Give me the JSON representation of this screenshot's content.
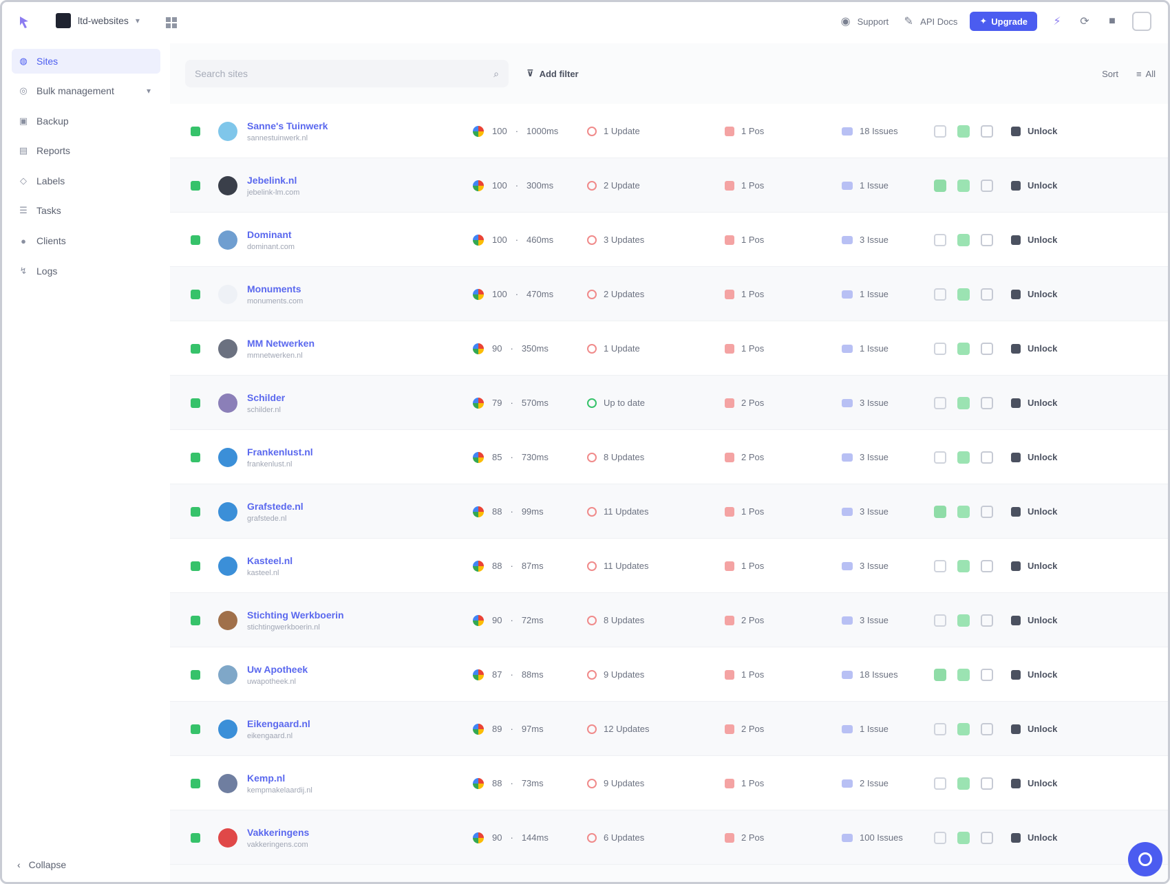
{
  "topbar": {
    "project_name": "ltd-websites",
    "support_label": "Support",
    "api_docs_label": "API Docs",
    "upgrade_label": "Upgrade"
  },
  "sidebar": {
    "items": [
      {
        "label": "Sites",
        "icon": "globe-icon",
        "active": true
      },
      {
        "label": "Bulk management",
        "icon": "layers-icon",
        "has_caret": true
      },
      {
        "label": "Backup",
        "icon": "database-icon"
      },
      {
        "label": "Reports",
        "icon": "file-icon"
      },
      {
        "label": "Labels",
        "icon": "tag-icon"
      },
      {
        "label": "Tasks",
        "icon": "checklist-icon"
      },
      {
        "label": "Clients",
        "icon": "users-icon"
      },
      {
        "label": "Logs",
        "icon": "log-icon"
      }
    ],
    "collapse_label": "Collapse"
  },
  "filters": {
    "search_placeholder": "Search sites",
    "add_filter_label": "Add filter",
    "sort_label": "Sort",
    "all_label": "All"
  },
  "colors": {
    "accent": "#4b5cf0",
    "status_ok": "#36c26a",
    "warning": "#f08a8a"
  },
  "sites": [
    {
      "name": "Sanne's Tuinwerk",
      "url": "sannestuinwerk.nl",
      "icon_color": "#7fc6ea",
      "perf_score": "100",
      "perf_time": "1000ms",
      "updates": "1 Update",
      "updates_ok": false,
      "backups": "1 Pos",
      "issues": "18 Issues",
      "act_green": false,
      "manager": "Unlock"
    },
    {
      "name": "Jebelink.nl",
      "url": "jebelink-lm.com",
      "icon_color": "#3a3f4a",
      "perf_score": "100",
      "perf_time": "300ms",
      "updates": "2 Update",
      "updates_ok": false,
      "backups": "1 Pos",
      "issues": "1 Issue",
      "act_green": true,
      "manager": "Unlock"
    },
    {
      "name": "Dominant",
      "url": "dominant.com",
      "icon_color": "#6f9ed0",
      "perf_score": "100",
      "perf_time": "460ms",
      "updates": "3 Updates",
      "updates_ok": false,
      "backups": "1 Pos",
      "issues": "3 Issue",
      "act_green": false,
      "manager": "Unlock"
    },
    {
      "name": "Monuments",
      "url": "monuments.com",
      "icon_color": "#eef1f6",
      "perf_score": "100",
      "perf_time": "470ms",
      "updates": "2 Updates",
      "updates_ok": false,
      "backups": "1 Pos",
      "issues": "1 Issue",
      "act_green": false,
      "manager": "Unlock"
    },
    {
      "name": "MM Netwerken",
      "url": "mmnetwerken.nl",
      "icon_color": "#6b7180",
      "perf_score": "90",
      "perf_time": "350ms",
      "updates": "1 Update",
      "updates_ok": false,
      "backups": "1 Pos",
      "issues": "1 Issue",
      "act_green": false,
      "manager": "Unlock"
    },
    {
      "name": "Schilder",
      "url": "schilder.nl",
      "icon_color": "#8b7fb8",
      "perf_score": "79",
      "perf_time": "570ms",
      "updates": "Up to date",
      "updates_ok": true,
      "backups": "2 Pos",
      "issues": "3 Issue",
      "act_green": false,
      "manager": "Unlock"
    },
    {
      "name": "Frankenlust.nl",
      "url": "frankenlust.nl",
      "icon_color": "#3b8fd8",
      "perf_score": "85",
      "perf_time": "730ms",
      "updates": "8 Updates",
      "updates_ok": false,
      "backups": "2 Pos",
      "issues": "3 Issue",
      "act_green": false,
      "manager": "Unlock"
    },
    {
      "name": "Grafstede.nl",
      "url": "grafstede.nl",
      "icon_color": "#3b8fd8",
      "perf_score": "88",
      "perf_time": "99ms",
      "updates": "11 Updates",
      "updates_ok": false,
      "backups": "1 Pos",
      "issues": "3 Issue",
      "act_green": true,
      "manager": "Unlock"
    },
    {
      "name": "Kasteel.nl",
      "url": "kasteel.nl",
      "icon_color": "#3b8fd8",
      "perf_score": "88",
      "perf_time": "87ms",
      "updates": "11 Updates",
      "updates_ok": false,
      "backups": "1 Pos",
      "issues": "3 Issue",
      "act_green": false,
      "manager": "Unlock"
    },
    {
      "name": "Stichting Werkboerin",
      "url": "stichtingwerkboerin.nl",
      "icon_color": "#a0704a",
      "perf_score": "90",
      "perf_time": "72ms",
      "updates": "8 Updates",
      "updates_ok": false,
      "backups": "2 Pos",
      "issues": "3 Issue",
      "act_green": false,
      "manager": "Unlock"
    },
    {
      "name": "Uw Apotheek",
      "url": "uwapotheek.nl",
      "icon_color": "#7fa7c8",
      "perf_score": "87",
      "perf_time": "88ms",
      "updates": "9 Updates",
      "updates_ok": false,
      "backups": "1 Pos",
      "issues": "18 Issues",
      "act_green": true,
      "manager": "Unlock"
    },
    {
      "name": "Eikengaard.nl",
      "url": "eikengaard.nl",
      "icon_color": "#3b8fd8",
      "perf_score": "89",
      "perf_time": "97ms",
      "updates": "12 Updates",
      "updates_ok": false,
      "backups": "2 Pos",
      "issues": "1 Issue",
      "act_green": false,
      "manager": "Unlock"
    },
    {
      "name": "Kemp.nl",
      "url": "kempmakelaardij.nl",
      "icon_color": "#6f7ea0",
      "perf_score": "88",
      "perf_time": "73ms",
      "updates": "9 Updates",
      "updates_ok": false,
      "backups": "1 Pos",
      "issues": "2 Issue",
      "act_green": false,
      "manager": "Unlock"
    },
    {
      "name": "Vakkeringens",
      "url": "vakkeringens.com",
      "icon_color": "#e04848",
      "perf_score": "90",
      "perf_time": "144ms",
      "updates": "6 Updates",
      "updates_ok": false,
      "backups": "2 Pos",
      "issues": "100 Issues",
      "act_green": false,
      "manager": "Unlock"
    }
  ]
}
